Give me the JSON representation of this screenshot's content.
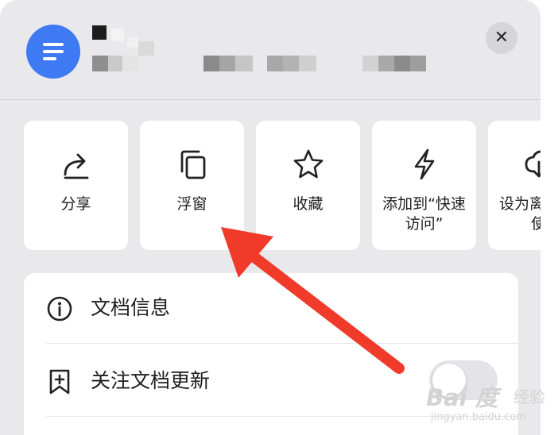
{
  "header": {
    "close_symbol": "✕",
    "app_icon": "document-list-icon"
  },
  "actions": [
    {
      "id": "share",
      "label": "分享",
      "icon": "share-icon"
    },
    {
      "id": "float",
      "label": "浮窗",
      "icon": "floating-window-icon"
    },
    {
      "id": "favorite",
      "label": "收藏",
      "icon": "star-icon"
    },
    {
      "id": "quick-access",
      "label_line1": "添加到“快速",
      "label_line2": "访问”",
      "icon": "lightning-icon"
    },
    {
      "id": "offline",
      "label_line1": "设为离",
      "label_line2": "使",
      "icon": "cloud-download-icon"
    }
  ],
  "list": {
    "items": [
      {
        "label": "文档信息",
        "icon": "info-icon"
      },
      {
        "label": "关注文档更新",
        "icon": "bookmark-add-icon",
        "toggle": "off"
      }
    ]
  },
  "watermark": {
    "logo": "Bai 度",
    "jingyan": "经验",
    "url": "jingyan.baidu.com"
  },
  "colors": {
    "sheet_bg": "#e9e9ec",
    "app_icon_blue": "#3e7af3",
    "arrow_red": "#f03b2b",
    "tile_bg": "#ffffff"
  }
}
